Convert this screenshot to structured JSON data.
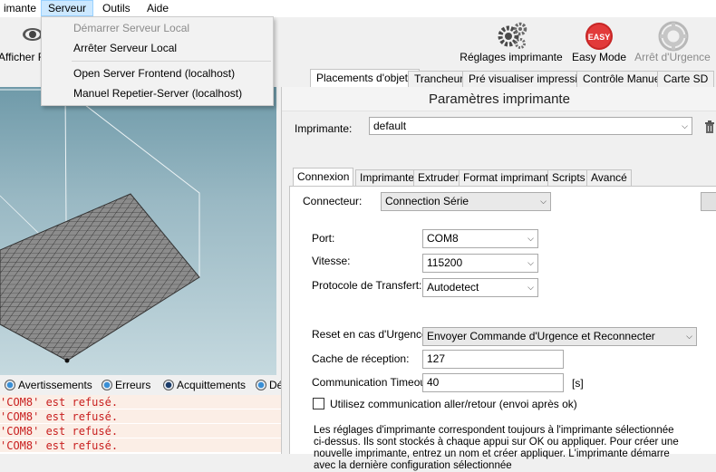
{
  "menubar": {
    "items": [
      {
        "label": "imante"
      },
      {
        "label": "Serveur"
      },
      {
        "label": "Outils"
      },
      {
        "label": "Aide"
      }
    ]
  },
  "toolbar": {
    "show_label": "Afficher F",
    "printer_settings_label": "Réglages imprimante",
    "easy_mode_label": "Easy Mode",
    "easy_badge": "EASY",
    "emergency_label": "Arrêt d'Urgence"
  },
  "server_menu": {
    "items": [
      {
        "label": "Démarrer Serveur Local",
        "enabled": false
      },
      {
        "label": "Arrêter Serveur Local",
        "enabled": true
      },
      {
        "label": "Open Server Frontend (localhost)",
        "enabled": true
      },
      {
        "label": "Manuel Repetier-Server (localhost)",
        "enabled": true
      }
    ]
  },
  "main_tabs": [
    {
      "label": "Placements d'objets",
      "active": true
    },
    {
      "label": "Trancheur",
      "active": false
    },
    {
      "label": "Pré visualiser impression",
      "active": false
    },
    {
      "label": "Contrôle Manuel",
      "active": false
    },
    {
      "label": "Carte SD",
      "active": false
    }
  ],
  "log": {
    "filters": [
      {
        "label": "Avertissements"
      },
      {
        "label": "Erreurs"
      },
      {
        "label": "Acquittements"
      },
      {
        "label": "Dé"
      }
    ],
    "lines": [
      "'COM8' est refusé.",
      "'COM8' est refusé.",
      "'COM8' est refusé.",
      "'COM8' est refusé."
    ]
  },
  "dialog": {
    "title": "Paramètres imprimante",
    "printer_label": "Imprimante:",
    "printer_value": "default",
    "tabs": [
      {
        "label": "Connexion",
        "active": true
      },
      {
        "label": "Imprimante",
        "active": false
      },
      {
        "label": "Extruder",
        "active": false
      },
      {
        "label": "Format imprimante",
        "active": false
      },
      {
        "label": "Scripts",
        "active": false
      },
      {
        "label": "Avancé",
        "active": false
      }
    ],
    "connector_label": "Connecteur:",
    "connector_value": "Connection Série",
    "port_label": "Port:",
    "port_value": "COM8",
    "speed_label": "Vitesse:",
    "speed_value": "115200",
    "protocol_label": "Protocole de Transfert:",
    "protocol_value": "Autodetect",
    "reset_label": "Reset en cas d'Urgence",
    "reset_value": "Envoyer Commande d'Urgence et Reconnecter",
    "cache_label": "Cache de réception:",
    "cache_value": "127",
    "timeout_label": "Communication Timeout:",
    "timeout_value": "40",
    "timeout_unit": "[s]",
    "pingpong_label": "Utilisez communication aller/retour (envoi après ok)",
    "pingpong_checked": false,
    "info_lines": [
      "Les réglages d'imprimante correspondent toujours à l'imprimante sélectionnée",
      "ci-dessus. Ils sont stockés à chaque appui sur OK ou appliquer. Pour créer une",
      "nouvelle imprimante, entrez un nom et créer appliquer. L'imprimante démarre",
      "avec la dernière configuration sélectionnée"
    ]
  },
  "colors": {
    "accent_tab": "#cce8ff",
    "easy_badge": "#d62828",
    "log_error": "#c81e1e"
  }
}
